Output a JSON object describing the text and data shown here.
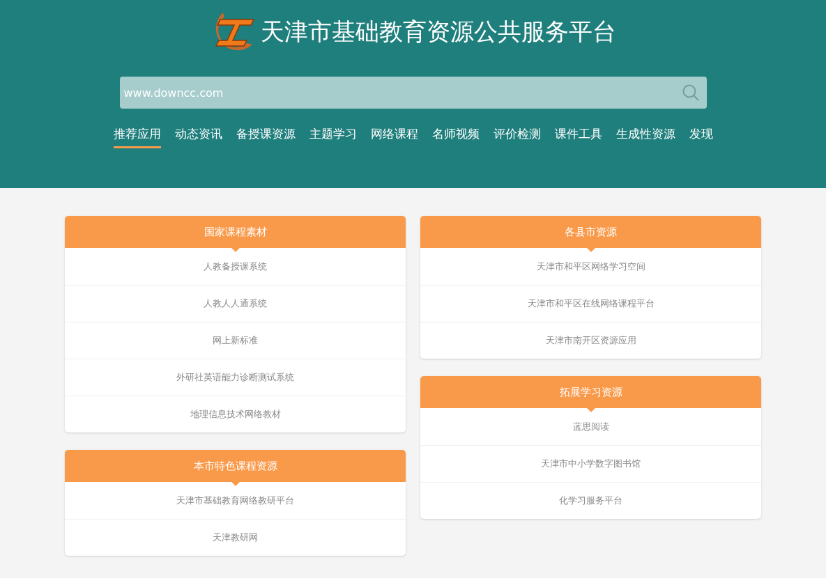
{
  "header": {
    "title": "天津市基础教育资源公共服务平台",
    "search": {
      "value": "www.downcc.com"
    },
    "nav": [
      {
        "label": "推荐应用",
        "selected": true
      },
      {
        "label": "动态资讯",
        "selected": false
      },
      {
        "label": "备授课资源",
        "selected": false
      },
      {
        "label": "主题学习",
        "selected": false
      },
      {
        "label": "网络课程",
        "selected": false
      },
      {
        "label": "名师视频",
        "selected": false
      },
      {
        "label": "评价检测",
        "selected": false
      },
      {
        "label": "课件工具",
        "selected": false
      },
      {
        "label": "生成性资源",
        "selected": false
      },
      {
        "label": "发现",
        "selected": false
      }
    ]
  },
  "columns": [
    [
      {
        "title": "国家课程素材",
        "items": [
          "人教备授课系统",
          "人教人人通系统",
          "网上新标准",
          "外研社英语能力诊断测试系统",
          "地理信息技术网络教材"
        ]
      },
      {
        "title": "本市特色课程资源",
        "items": [
          "天津市基础教育网络教研平台",
          "天津教研网"
        ]
      }
    ],
    [
      {
        "title": "各县市资源",
        "items": [
          "天津市和平区网络学习空间",
          "天津市和平区在线网络课程平台",
          "天津市南开区资源应用"
        ]
      },
      {
        "title": "拓展学习资源",
        "items": [
          "蓝思阅读",
          "天津市中小学数字图书馆",
          "化学习服务平台"
        ]
      }
    ]
  ]
}
